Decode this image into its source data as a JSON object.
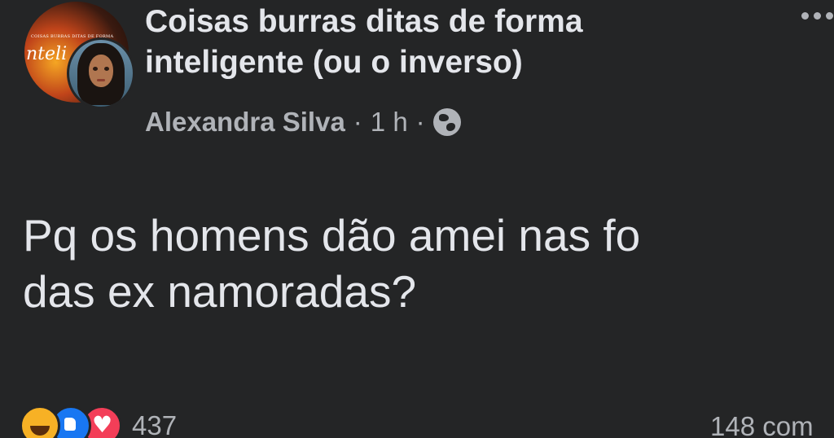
{
  "post": {
    "group_name": "Coisas burras ditas de forma inteligente (ou o inverso)",
    "author": "Alexandra Silva",
    "separator": "·",
    "time": "1 h",
    "privacy_icon": "globe-icon",
    "avatar_banner_text": "COISAS BURRAS DITAS DE FORMA",
    "avatar_cursive_text": "nteli",
    "text_line_1": "Pq os homens dão amei nas fo",
    "text_line_2": "das ex namoradas?"
  },
  "footer": {
    "reaction_icons": [
      "haha-icon",
      "like-icon",
      "love-icon"
    ],
    "reaction_count": "437",
    "comments_text": "148 com"
  },
  "colors": {
    "background": "#242526",
    "text_primary": "#e4e6eb",
    "text_secondary": "#b0b3b8",
    "like_blue": "#1877f2",
    "love_red": "#f33e58",
    "haha_yellow": "#f7b125"
  }
}
